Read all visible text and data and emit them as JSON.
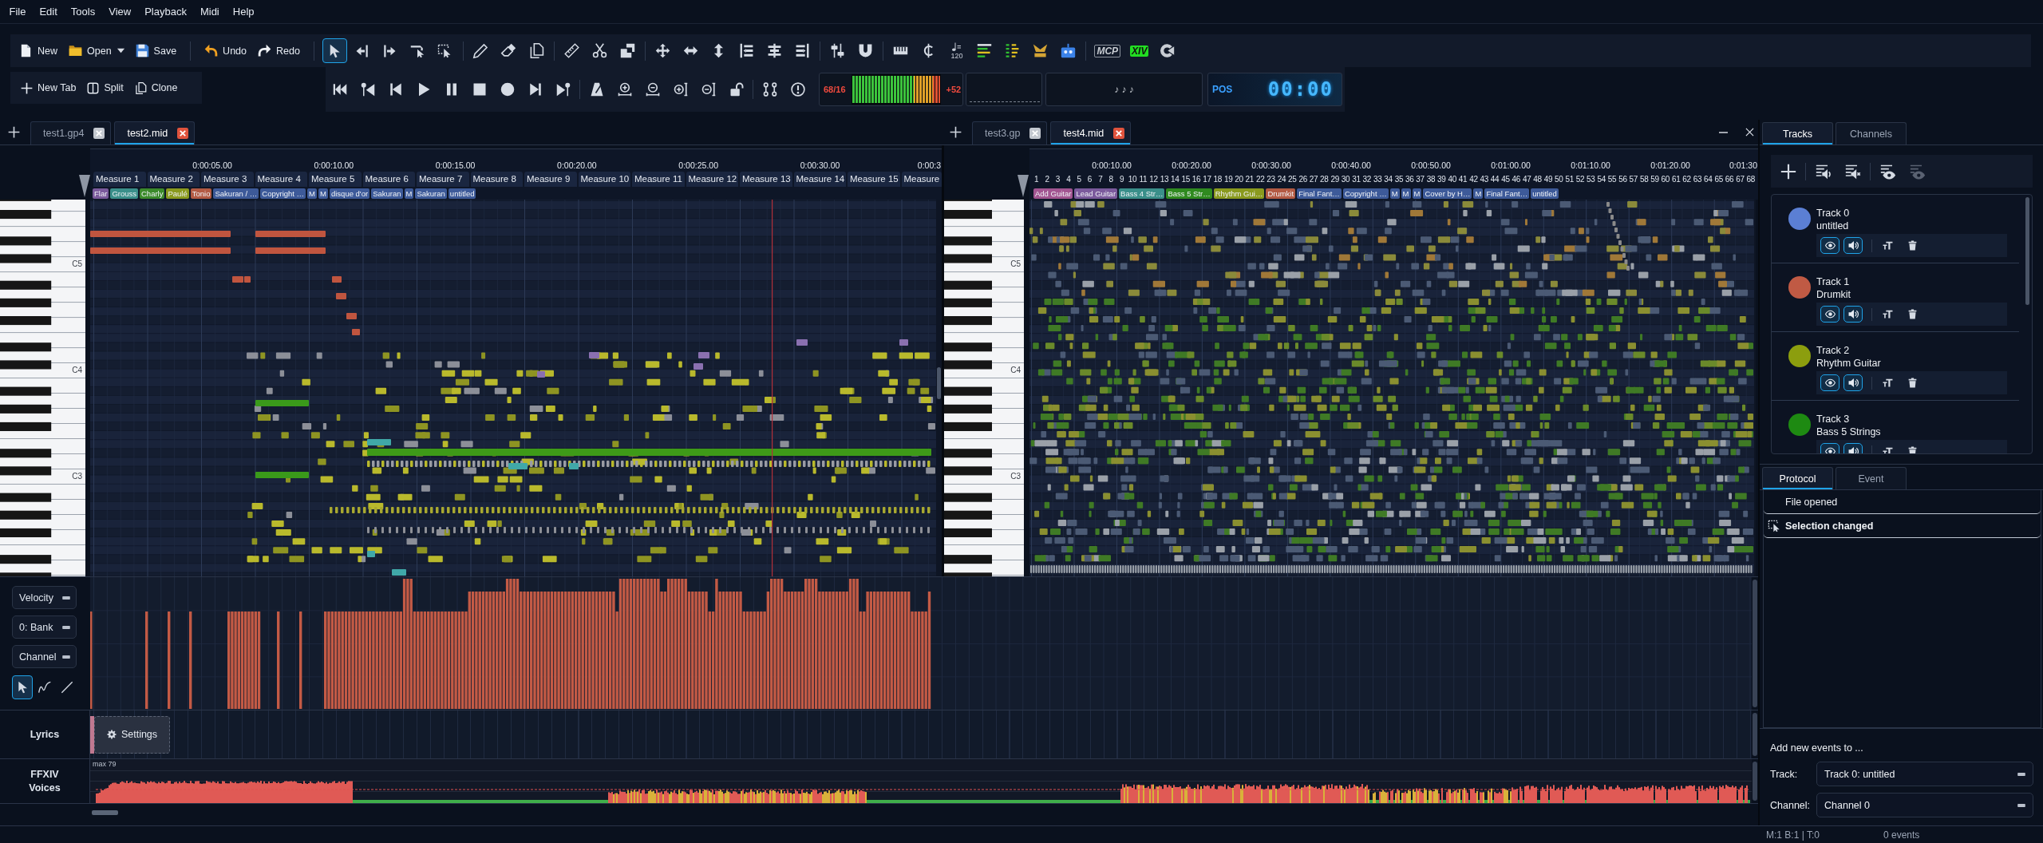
{
  "menu": [
    "File",
    "Edit",
    "Tools",
    "View",
    "Playback",
    "Midi",
    "Help"
  ],
  "toolbar": {
    "file_buttons": [
      "New",
      "Open",
      "Save",
      "Undo",
      "Redo"
    ],
    "edit_tools": [
      {
        "selected": true
      },
      {
        "selected": false
      },
      {
        "selected": false
      },
      {
        "selected": false
      },
      {
        "selected": false
      }
    ],
    "tempo": "120",
    "plugins": [
      "MCP",
      "XIV"
    ],
    "view_buttons": [
      "New Tab",
      "Split",
      "Clone"
    ],
    "meter": {
      "reading": "68/16",
      "level": 1,
      "peak": "+52"
    },
    "beat_display": "♪ ♪ ♪",
    "position": {
      "label": "POS",
      "time": "00:00"
    }
  },
  "editors": [
    {
      "tabs": [
        {
          "label": "test1.gp4",
          "selected": false
        },
        {
          "label": "test2.mid",
          "selected": true
        }
      ],
      "times": [
        "0:00:05.00",
        "0:00:10.00",
        "0:00:15.00",
        "0:00:20.00",
        "0:00:25.00",
        "0:00:30.00",
        "0:00:3"
      ],
      "measures": [
        "Measure 1",
        "Measure 2",
        "Measure 3",
        "Measure 4",
        "Measure 5",
        "Measure 6",
        "Measure 7",
        "Measure 8",
        "Measure 9",
        "Measure 10",
        "Measure 11",
        "Measure 12",
        "Measure 13",
        "Measure 14",
        "Measure 15",
        "Measure"
      ],
      "tracks": [
        {
          "label": "Flar",
          "color": "#7b5a9c"
        },
        {
          "label": "Grouss",
          "color": "#3a8f8a"
        },
        {
          "label": "Charly",
          "color": "#3b8a2b"
        },
        {
          "label": "Paulé",
          "color": "#8a9a1e"
        },
        {
          "label": "Tonio",
          "color": "#b35a43"
        },
        {
          "label": "Sakuran / …",
          "color": "#3d5a99"
        },
        {
          "label": "Copyright …",
          "color": "#3d5a99"
        },
        {
          "label": "M",
          "color": "#3d5a99"
        },
        {
          "label": "M",
          "color": "#3d5a99"
        },
        {
          "label": "disque d'or",
          "color": "#3d5a99"
        },
        {
          "label": "Sakuran",
          "color": "#3d5a99"
        },
        {
          "label": "M",
          "color": "#3d5a99"
        },
        {
          "label": "Sakuran",
          "color": "#3d5a99"
        },
        {
          "label": "untitled",
          "color": "#3d5a99"
        }
      ],
      "octaves": [
        "C5",
        "C4",
        "C3"
      ]
    },
    {
      "tabs": [
        {
          "label": "test3.gp",
          "selected": false
        },
        {
          "label": "test4.mid",
          "selected": true
        }
      ],
      "times": [
        "0:00:10.00",
        "0:00:20.00",
        "0:00:30.00",
        "0:00:40.00",
        "0:00:50.00",
        "0:01:00.00",
        "0:01:10.00",
        "0:01:20.00",
        "0:01:30"
      ],
      "measures": [
        "1",
        "2",
        "3",
        "4",
        "5",
        "6",
        "7",
        "8",
        "9",
        "10",
        "11",
        "12",
        "13",
        "14",
        "15",
        "16",
        "17",
        "18",
        "19",
        "20",
        "21",
        "22",
        "23",
        "24",
        "25",
        "26",
        "27",
        "28",
        "29",
        "30",
        "31",
        "32",
        "33",
        "34",
        "35",
        "36",
        "37",
        "38",
        "39",
        "40",
        "41",
        "42",
        "43",
        "44",
        "45",
        "46",
        "47",
        "48",
        "49",
        "50",
        "51",
        "52",
        "53",
        "54",
        "55",
        "56",
        "57",
        "58",
        "59",
        "60",
        "61",
        "62",
        "63",
        "64",
        "65",
        "66",
        "67",
        "68"
      ],
      "tracks": [
        {
          "label": "Add Guitar",
          "color": "#a25591"
        },
        {
          "label": "Lead Guitar",
          "color": "#7b5a9c"
        },
        {
          "label": "Bass 4 Str…",
          "color": "#3a8f8a"
        },
        {
          "label": "Bass 5 Str…",
          "color": "#2f8a1f"
        },
        {
          "label": "Rhythm Gui…",
          "color": "#8a9a1e"
        },
        {
          "label": "Drumkit",
          "color": "#b35a43"
        },
        {
          "label": "Final Fant…",
          "color": "#3d5a99"
        },
        {
          "label": "Copyright …",
          "color": "#3d5a99"
        },
        {
          "label": "M",
          "color": "#3d5a99"
        },
        {
          "label": "M",
          "color": "#3d5a99"
        },
        {
          "label": "M",
          "color": "#3d5a99"
        },
        {
          "label": "Cover by H…",
          "color": "#3d5a99"
        },
        {
          "label": "M",
          "color": "#3d5a99"
        },
        {
          "label": "Final Fant…",
          "color": "#3d5a99"
        },
        {
          "label": "untitled",
          "color": "#3d5a99"
        }
      ],
      "octaves": [
        "C5",
        "C4",
        "C3"
      ]
    }
  ],
  "lanes": {
    "selectors": [
      "Velocity",
      "0: Bank",
      "Channel"
    ],
    "tools": [
      {
        "selected": true
      },
      {
        "selected": false
      },
      {
        "selected": false
      }
    ],
    "lyrics": {
      "label": "Lyrics",
      "button": "Settings"
    },
    "voices": {
      "label": "FFXIV Voices",
      "max": "max 79"
    }
  },
  "side_panel": {
    "tabs": [
      {
        "label": "Tracks",
        "selected": true
      },
      {
        "label": "Channels",
        "selected": false
      }
    ],
    "tracks": [
      {
        "number": "Track 0",
        "name": "untitled",
        "color": "#5b7fd4",
        "visible": true,
        "audible": true
      },
      {
        "number": "Track 1",
        "name": "Drumkit",
        "color": "#c05a44",
        "visible": true,
        "audible": true
      },
      {
        "number": "Track 2",
        "name": "Rhythm Guitar",
        "color": "#8c9e0e",
        "visible": true,
        "audible": true
      },
      {
        "number": "Track 3",
        "name": "Bass 5 Strings",
        "color": "#1e8a12",
        "visible": true,
        "audible": true
      }
    ],
    "log_tabs": [
      {
        "label": "Protocol",
        "selected": true
      },
      {
        "label": "Event",
        "selected": false
      }
    ],
    "log": [
      {
        "text": "File opened",
        "kind": "plain",
        "selected": false
      },
      {
        "text": "Selection changed",
        "kind": "selection",
        "selected": true
      }
    ],
    "add_events": {
      "title": "Add new events to ...",
      "fields": [
        {
          "label": "Track:",
          "value": "Track 0: untitled"
        },
        {
          "label": "Channel:",
          "value": "Channel 0"
        }
      ]
    }
  },
  "status_bar": {
    "position": "M:1 B:1 | T:0",
    "events": "0 events"
  }
}
